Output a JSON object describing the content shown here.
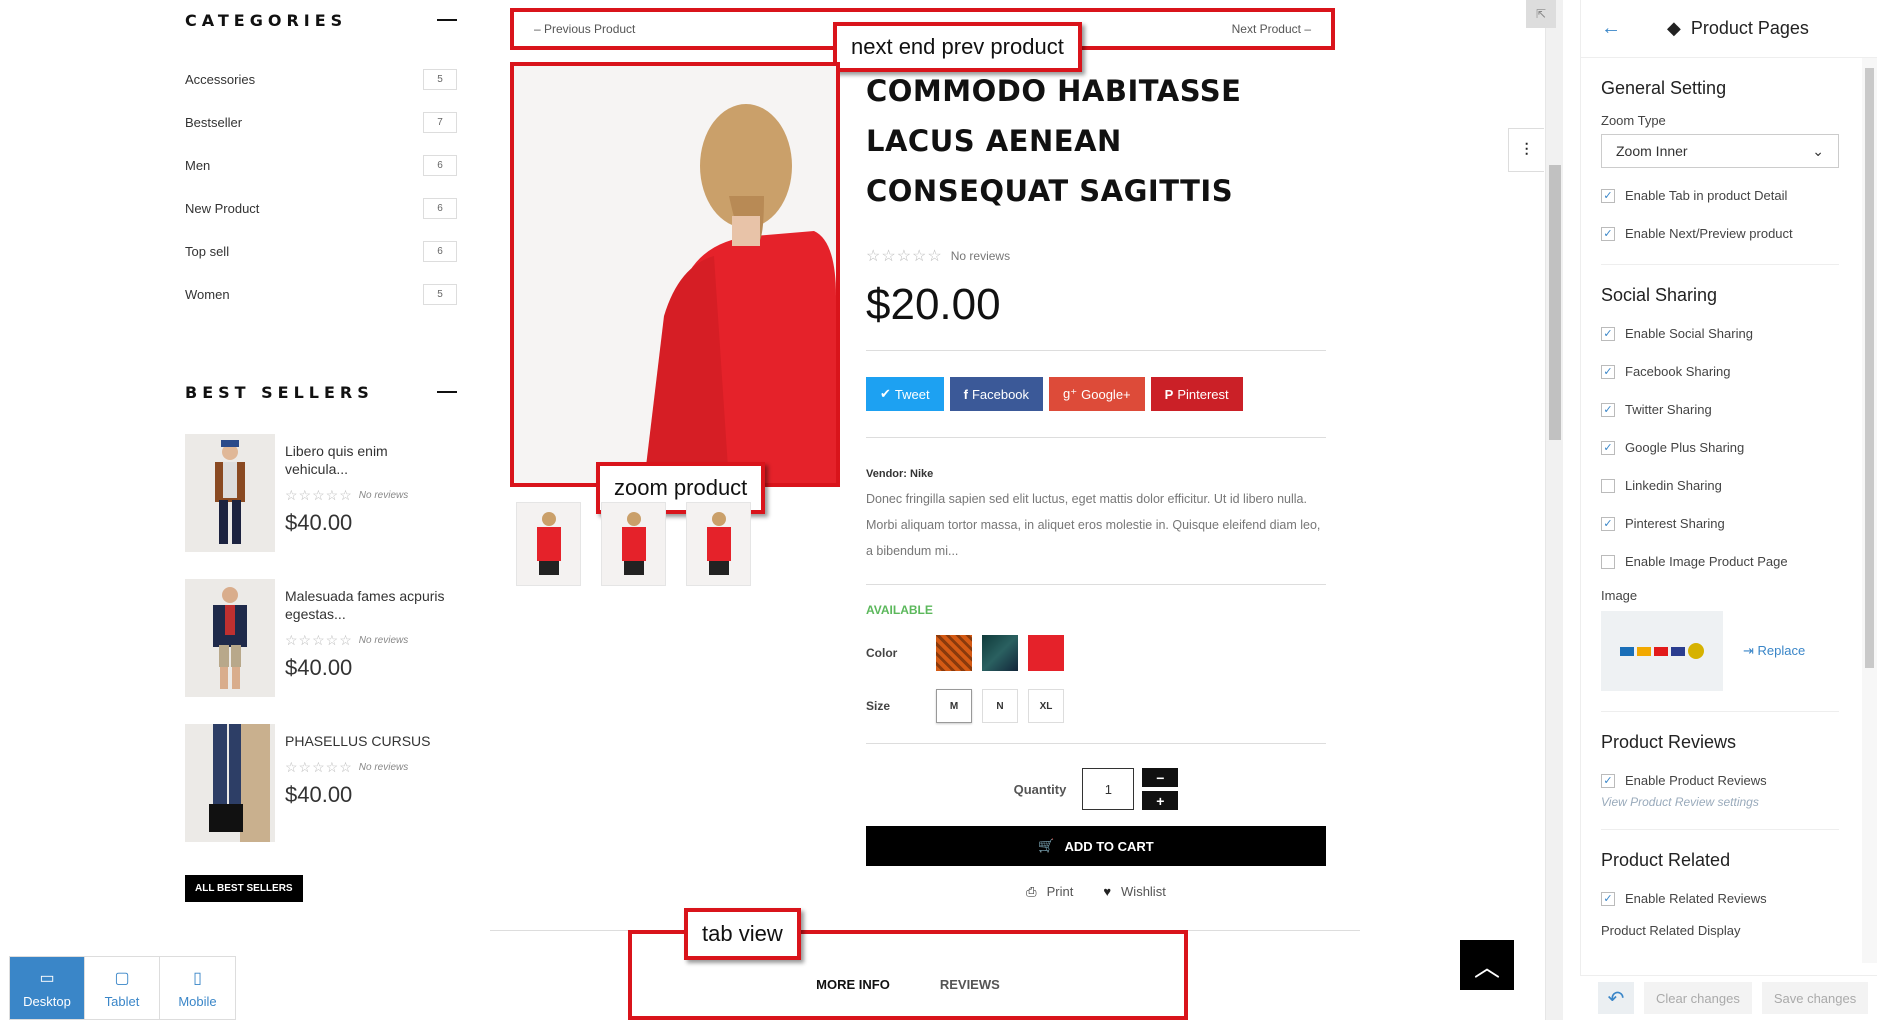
{
  "sidebar": {
    "categories_title": "CATEGORIES",
    "categories": [
      {
        "label": "Accessories",
        "count": "5"
      },
      {
        "label": "Bestseller",
        "count": "7"
      },
      {
        "label": "Men",
        "count": "6"
      },
      {
        "label": "New Product",
        "count": "6"
      },
      {
        "label": "Top sell",
        "count": "6"
      },
      {
        "label": "Women",
        "count": "5"
      }
    ],
    "best_title": "BEST SELLERS",
    "best_sellers": [
      {
        "name": "Libero quis enim vehicula...",
        "reviews": "No reviews",
        "price": "$40.00"
      },
      {
        "name": "Malesuada fames acpuris egestas...",
        "reviews": "No reviews",
        "price": "$40.00"
      },
      {
        "name": "PHASELLUS CURSUS",
        "reviews": "No reviews",
        "price": "$40.00"
      }
    ],
    "all_best_label": "ALL BEST SELLERS"
  },
  "devices": [
    {
      "label": "Desktop",
      "icon": "desktop-icon",
      "active": true
    },
    {
      "label": "Tablet",
      "icon": "tablet-icon",
      "active": false
    },
    {
      "label": "Mobile",
      "icon": "mobile-icon",
      "active": false
    }
  ],
  "product": {
    "prev_label": "– Previous Product",
    "next_label": "Next Product –",
    "title": "COMMODO HABITASSE LACUS AENEAN CONSEQUAT SAGITTIS",
    "reviews": "No reviews",
    "price": "$20.00",
    "shares": [
      {
        "label": "Tweet",
        "icon": "twitter-icon",
        "color": "#1da1f2"
      },
      {
        "label": "Facebook",
        "icon": "facebook-icon",
        "color": "#3b5998"
      },
      {
        "label": "Google+",
        "icon": "google-plus-icon",
        "color": "#dd4b39"
      },
      {
        "label": "Pinterest",
        "icon": "pinterest-icon",
        "color": "#cb2027"
      }
    ],
    "vendor": "Vendor: Nike",
    "description": "Donec fringilla sapien sed elit luctus, eget mattis dolor efficitur. Ut id libero nulla. Morbi aliquam tortor massa, in aliquet eros molestie in. Quisque eleifend diam leo, a bibendum mi...",
    "availability": "AVAILABLE",
    "color_label": "Color",
    "size_label": "Size",
    "sizes": [
      "M",
      "N",
      "XL"
    ],
    "quantity_label": "Quantity",
    "quantity": "1",
    "add_to_cart": "ADD TO CART",
    "print_label": "Print",
    "wishlist_label": "Wishlist",
    "tabs": [
      "MORE INFO",
      "REVIEWS"
    ]
  },
  "annotations": {
    "nextprev": "next end prev product",
    "zoom": "zoom product",
    "tabview": "tab view"
  },
  "panel": {
    "title": "Product Pages",
    "general_title": "General Setting",
    "zoom_type_label": "Zoom Type",
    "zoom_type_value": "Zoom Inner",
    "general_checks": [
      {
        "label": "Enable Tab in product Detail",
        "checked": true
      },
      {
        "label": "Enable Next/Preview product",
        "checked": true
      }
    ],
    "social_title": "Social Sharing",
    "social_checks": [
      {
        "label": "Enable Social Sharing",
        "checked": true
      },
      {
        "label": "Facebook Sharing",
        "checked": true
      },
      {
        "label": "Twitter Sharing",
        "checked": true
      },
      {
        "label": "Google Plus Sharing",
        "checked": true
      },
      {
        "label": "Linkedin Sharing",
        "checked": false
      },
      {
        "label": "Pinterest Sharing",
        "checked": true
      },
      {
        "label": "Enable Image Product Page",
        "checked": false
      }
    ],
    "image_label": "Image",
    "replace_label": "Replace",
    "reviews_title": "Product Reviews",
    "reviews_check": "Enable Product Reviews",
    "reviews_link": "View Product Review settings",
    "related_title": "Product Related",
    "related_check": "Enable Related Reviews",
    "related_display_label": "Product Related Display",
    "clear_label": "Clear changes",
    "save_label": "Save changes"
  }
}
